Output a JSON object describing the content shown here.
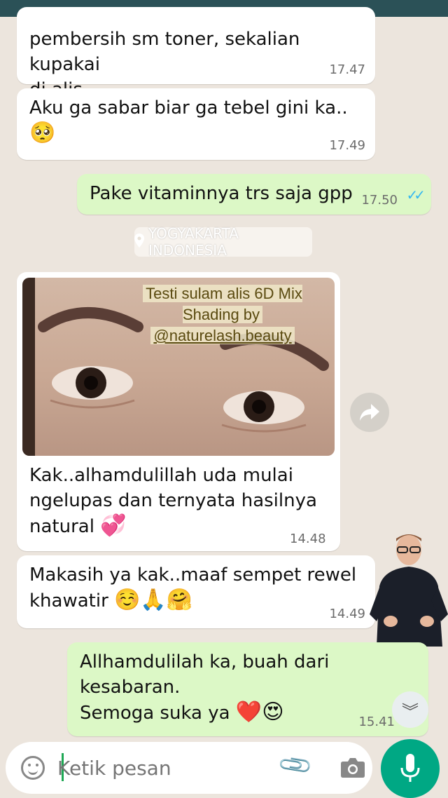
{
  "messages": [
    {
      "dir": "in",
      "text": "pembersih sm toner, sekalian kupakai\ndi alis..",
      "time": "17.47"
    },
    {
      "dir": "in",
      "text": "Aku ga sabar biar ga tebel gini ka..",
      "emoji": "🥺",
      "time": "17.49"
    },
    {
      "dir": "out",
      "text": "Pake vitaminnya trs saja gpp",
      "time": "17.50"
    },
    {
      "dir": "in",
      "text": "Kak..alhamdulillah uda mulai\nngelupas dan ternyata hasilnya\nnatural",
      "emoji": "💞",
      "time": "14.48"
    },
    {
      "dir": "in",
      "text": "Makasih ya kak..maaf sempet rewel\nkhawatir",
      "emoji": "☺️🙏🤗",
      "time": "14.49"
    },
    {
      "dir": "out",
      "text": "Allhamdulilah ka, buah dari\nkesabaran.\nSemoga suka ya",
      "emoji": "❤️😍",
      "time": "15.41"
    }
  ],
  "location_chip": "YOGYAKARTA INDONESIA",
  "photo": {
    "caption_line1": "Testi sulam alis 6D Mix Shading by",
    "caption_line2": "@naturelash.beauty"
  },
  "composer": {
    "placeholder": "Ketik pesan"
  },
  "colors": {
    "incoming": "#ffffff",
    "outgoing": "#dcf8c6",
    "background": "#ece5dd",
    "accent": "#00a884",
    "read_ticks": "#34b7f1"
  },
  "icons": [
    "emoji-icon",
    "attach-icon",
    "camera-icon",
    "mic-icon",
    "forward-icon",
    "double-chevron-down-icon",
    "location-pin-icon",
    "double-check-icon"
  ]
}
